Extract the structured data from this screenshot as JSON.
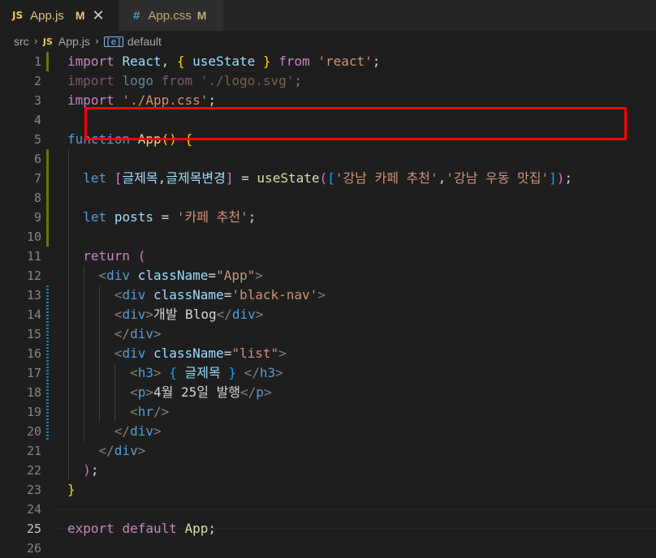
{
  "tabs": [
    {
      "icon": "JS",
      "title": "App.js",
      "modified": "M",
      "close": "✕"
    },
    {
      "icon": "#",
      "title": "App.css",
      "modified": "M"
    }
  ],
  "breadcrumb": {
    "folder": "src",
    "file_icon": "JS",
    "file": "App.js",
    "symbol_icon": "[e]",
    "symbol": "default"
  },
  "colors": {
    "editor_bg": "#1e1e1e",
    "highlight_box": "#ff0000",
    "added_gutter": "#587c0c",
    "modified_gutter": "#1b81a8"
  },
  "lines": [
    {
      "n": "1",
      "tokens": [
        [
          "kwc",
          "import"
        ],
        [
          "pun",
          " "
        ],
        [
          "var",
          "React"
        ],
        [
          "pun",
          ", "
        ],
        [
          "br1",
          "{"
        ],
        [
          "pun",
          " "
        ],
        [
          "var",
          "useState"
        ],
        [
          "pun",
          " "
        ],
        [
          "br1",
          "}"
        ],
        [
          "pun",
          " "
        ],
        [
          "kwc",
          "from"
        ],
        [
          "pun",
          " "
        ],
        [
          "str",
          "'react'"
        ],
        [
          "pun",
          ";"
        ]
      ]
    },
    {
      "n": "2",
      "faded": true,
      "tokens": [
        [
          "kwc",
          "import"
        ],
        [
          "pun",
          " "
        ],
        [
          "var",
          "logo"
        ],
        [
          "pun",
          " "
        ],
        [
          "kwc",
          "from"
        ],
        [
          "pun",
          " "
        ],
        [
          "str",
          "'./logo.svg'"
        ],
        [
          "pun",
          ";"
        ]
      ]
    },
    {
      "n": "3",
      "tokens": [
        [
          "kwc",
          "import"
        ],
        [
          "pun",
          " "
        ],
        [
          "str",
          "'./App.css'"
        ],
        [
          "pun",
          ";"
        ]
      ]
    },
    {
      "n": "4",
      "tokens": []
    },
    {
      "n": "5",
      "tokens": [
        [
          "kw",
          "function"
        ],
        [
          "pun",
          " "
        ],
        [
          "fn",
          "App"
        ],
        [
          "br1",
          "()"
        ],
        [
          "pun",
          " "
        ],
        [
          "br1",
          "{"
        ]
      ]
    },
    {
      "n": "6",
      "tokens": []
    },
    {
      "n": "7",
      "tokens": [
        [
          "pun",
          "  "
        ],
        [
          "kw",
          "let"
        ],
        [
          "pun",
          " "
        ],
        [
          "br2",
          "["
        ],
        [
          "var",
          "글제목"
        ],
        [
          "pun",
          ","
        ],
        [
          "var",
          "글제목변경"
        ],
        [
          "br2",
          "]"
        ],
        [
          "pun",
          " = "
        ],
        [
          "fn",
          "useState"
        ],
        [
          "br2",
          "("
        ],
        [
          "br3",
          "["
        ],
        [
          "str",
          "'강남 카페 추천'"
        ],
        [
          "pun",
          ","
        ],
        [
          "str",
          "'강남 우동 맛집'"
        ],
        [
          "br3",
          "]"
        ],
        [
          "br2",
          ")"
        ],
        [
          "pun",
          ";"
        ]
      ]
    },
    {
      "n": "8",
      "tokens": []
    },
    {
      "n": "9",
      "tokens": [
        [
          "pun",
          "  "
        ],
        [
          "kw",
          "let"
        ],
        [
          "pun",
          " "
        ],
        [
          "var",
          "posts"
        ],
        [
          "pun",
          " = "
        ],
        [
          "str",
          "'카페 추천'"
        ],
        [
          "pun",
          ";"
        ]
      ]
    },
    {
      "n": "10",
      "tokens": []
    },
    {
      "n": "11",
      "tokens": [
        [
          "pun",
          "  "
        ],
        [
          "kwc",
          "return"
        ],
        [
          "pun",
          " "
        ],
        [
          "br2",
          "("
        ]
      ]
    },
    {
      "n": "12",
      "tokens": [
        [
          "pun",
          "    "
        ],
        [
          "tagbr",
          "<"
        ],
        [
          "tag",
          "div"
        ],
        [
          "pun",
          " "
        ],
        [
          "attr",
          "className"
        ],
        [
          "pun",
          "="
        ],
        [
          "str",
          "\"App\""
        ],
        [
          "tagbr",
          ">"
        ]
      ]
    },
    {
      "n": "13",
      "tokens": [
        [
          "pun",
          "      "
        ],
        [
          "tagbr",
          "<"
        ],
        [
          "tag",
          "div"
        ],
        [
          "pun",
          " "
        ],
        [
          "attr",
          "className"
        ],
        [
          "pun",
          "="
        ],
        [
          "str",
          "'black-nav'"
        ],
        [
          "tagbr",
          ">"
        ]
      ]
    },
    {
      "n": "14",
      "tokens": [
        [
          "pun",
          "      "
        ],
        [
          "tagbr",
          "<"
        ],
        [
          "tag",
          "div"
        ],
        [
          "tagbr",
          ">"
        ],
        [
          "txt",
          "개발 Blog"
        ],
        [
          "tagbr",
          "</"
        ],
        [
          "tag",
          "div"
        ],
        [
          "tagbr",
          ">"
        ]
      ]
    },
    {
      "n": "15",
      "tokens": [
        [
          "pun",
          "      "
        ],
        [
          "tagbr",
          "</"
        ],
        [
          "tag",
          "div"
        ],
        [
          "tagbr",
          ">"
        ]
      ]
    },
    {
      "n": "16",
      "tokens": [
        [
          "pun",
          "      "
        ],
        [
          "tagbr",
          "<"
        ],
        [
          "tag",
          "div"
        ],
        [
          "pun",
          " "
        ],
        [
          "attr",
          "className"
        ],
        [
          "pun",
          "="
        ],
        [
          "str",
          "\"list\""
        ],
        [
          "tagbr",
          ">"
        ]
      ]
    },
    {
      "n": "17",
      "tokens": [
        [
          "pun",
          "        "
        ],
        [
          "tagbr",
          "<"
        ],
        [
          "tag",
          "h3"
        ],
        [
          "tagbr",
          ">"
        ],
        [
          "pun",
          " "
        ],
        [
          "br3",
          "{"
        ],
        [
          "pun",
          " "
        ],
        [
          "var",
          "글제목"
        ],
        [
          "pun",
          " "
        ],
        [
          "br3",
          "}"
        ],
        [
          "pun",
          " "
        ],
        [
          "tagbr",
          "</"
        ],
        [
          "tag",
          "h3"
        ],
        [
          "tagbr",
          ">"
        ]
      ]
    },
    {
      "n": "18",
      "tokens": [
        [
          "pun",
          "        "
        ],
        [
          "tagbr",
          "<"
        ],
        [
          "tag",
          "p"
        ],
        [
          "tagbr",
          ">"
        ],
        [
          "txt",
          "4월 25일 발행"
        ],
        [
          "tagbr",
          "</"
        ],
        [
          "tag",
          "p"
        ],
        [
          "tagbr",
          ">"
        ]
      ]
    },
    {
      "n": "19",
      "tokens": [
        [
          "pun",
          "        "
        ],
        [
          "tagbr",
          "<"
        ],
        [
          "tag",
          "hr"
        ],
        [
          "tagbr",
          "/>"
        ]
      ]
    },
    {
      "n": "20",
      "tokens": [
        [
          "pun",
          "      "
        ],
        [
          "tagbr",
          "</"
        ],
        [
          "tag",
          "div"
        ],
        [
          "tagbr",
          ">"
        ]
      ]
    },
    {
      "n": "21",
      "tokens": [
        [
          "pun",
          "    "
        ],
        [
          "tagbr",
          "</"
        ],
        [
          "tag",
          "div"
        ],
        [
          "tagbr",
          ">"
        ]
      ]
    },
    {
      "n": "22",
      "tokens": [
        [
          "pun",
          "  "
        ],
        [
          "br2",
          ")"
        ],
        [
          "pun",
          ";"
        ]
      ]
    },
    {
      "n": "23",
      "tokens": [
        [
          "br1",
          "}"
        ]
      ]
    },
    {
      "n": "24",
      "tokens": []
    },
    {
      "n": "25",
      "active": true,
      "tokens": [
        [
          "kwc",
          "export"
        ],
        [
          "pun",
          " "
        ],
        [
          "kwc",
          "default"
        ],
        [
          "pun",
          " "
        ],
        [
          "fn",
          "App"
        ],
        [
          "pun",
          ";"
        ]
      ]
    },
    {
      "n": "26",
      "tokens": []
    }
  ]
}
